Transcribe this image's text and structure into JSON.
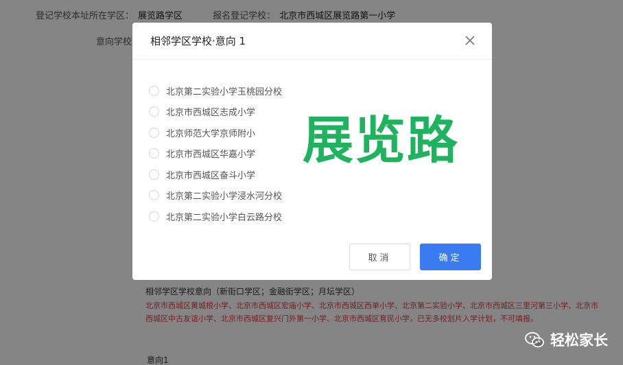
{
  "background": {
    "row1": {
      "label1": "登记学校本址所在学区：",
      "value1": "展览路学区",
      "label2": "报名登记学校：",
      "value2": "北京市西城区展览路第一小学"
    },
    "row2_label": "意向学校",
    "heading": "相邻学区学校意向（新街口学区；金融街学区；月坛学区）",
    "red_note": "北京市西城区黄城根小学、北京市西城区宏庙小学、北京市西城区西单小学、北京第二实验小学、北京市西城区三里河第三小学、北京市西城区中古友谊小学、北京市西城区复兴门外第一小学、北京市西城区育民小学，已无多校划片入学计划，不可填报。",
    "footer_label": "意向1"
  },
  "modal": {
    "title": "相邻学区学校·意向 1",
    "close_icon": "close-icon",
    "options": [
      "北京第二实验小学玉桃园分校",
      "北京市西城区志成小学",
      "北京师范大学京师附小",
      "北京市西城区华嘉小学",
      "北京市西城区奋斗小学",
      "北京第二实验小学浸水河分校",
      "北京第二实验小学白云路分校"
    ],
    "watermark": "展览路",
    "cancel_label": "取消",
    "ok_label": "确定"
  },
  "wechat": {
    "icon": "wechat-icon",
    "label": "轻松家长"
  },
  "colors": {
    "primary": "#3a7bf2",
    "watermark": "#1fb35f",
    "warning_text": "#e03c3c"
  }
}
